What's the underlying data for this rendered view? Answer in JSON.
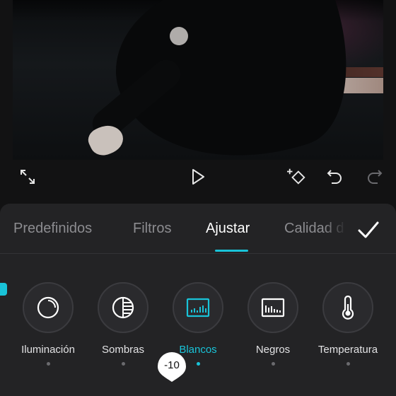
{
  "player": {
    "fullscreen_icon": "fullscreen-icon",
    "play_icon": "play-icon",
    "keyframe_icon": "add-keyframe-icon",
    "undo_icon": "undo-icon",
    "redo_icon": "redo-icon"
  },
  "tabs": [
    {
      "label": "Predefinidos",
      "active": false
    },
    {
      "label": "Filtros",
      "active": false
    },
    {
      "label": "Ajustar",
      "active": true
    },
    {
      "label": "Calidad d",
      "active": false
    }
  ],
  "tools": [
    {
      "label": "Iluminación",
      "icon": "brightness-icon",
      "active": false
    },
    {
      "label": "Sombras",
      "icon": "shadows-icon",
      "active": false
    },
    {
      "label": "Blancos",
      "icon": "whites-histogram-icon",
      "active": true
    },
    {
      "label": "Negros",
      "icon": "blacks-histogram-icon",
      "active": false
    },
    {
      "label": "Temperatura",
      "icon": "thermometer-icon",
      "active": false
    }
  ],
  "slider": {
    "value": "-10"
  },
  "colors": {
    "accent": "#19c3d8",
    "panel": "#232325",
    "background": "#121213"
  }
}
